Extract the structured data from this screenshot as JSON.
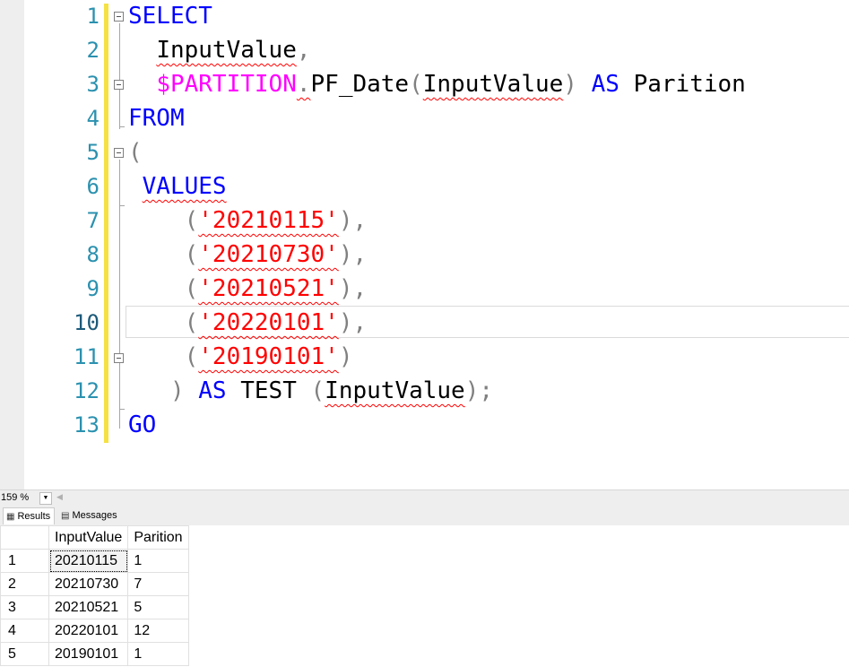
{
  "editor": {
    "line_numbers": [
      "1",
      "2",
      "3",
      "4",
      "5",
      "6",
      "7",
      "8",
      "9",
      "10",
      "11",
      "12",
      "13"
    ],
    "lines": [
      [
        {
          "t": "SELECT",
          "c": "kw"
        }
      ],
      [
        {
          "t": "  "
        },
        {
          "t": "InputValue",
          "c": "sq"
        },
        {
          "t": ",",
          "c": "op"
        }
      ],
      [
        {
          "t": "  "
        },
        {
          "t": "$PARTITION",
          "c": "fn"
        },
        {
          "t": ".",
          "c": "op sq"
        },
        {
          "t": "PF_Date"
        },
        {
          "t": "(",
          "c": "op"
        },
        {
          "t": "InputValue",
          "c": "sq"
        },
        {
          "t": ")",
          "c": "op"
        },
        {
          "t": " "
        },
        {
          "t": "AS",
          "c": "kw"
        },
        {
          "t": " Parition"
        }
      ],
      [
        {
          "t": "FROM",
          "c": "kw"
        }
      ],
      [
        {
          "t": "(",
          "c": "op"
        }
      ],
      [
        {
          "t": " "
        },
        {
          "t": "VALUES",
          "c": "kw sq"
        }
      ],
      [
        {
          "t": "    "
        },
        {
          "t": "(",
          "c": "op"
        },
        {
          "t": "'20210115'",
          "c": "str sq"
        },
        {
          "t": "),",
          "c": "op"
        }
      ],
      [
        {
          "t": "    "
        },
        {
          "t": "(",
          "c": "op"
        },
        {
          "t": "'20210730'",
          "c": "str sq"
        },
        {
          "t": "),",
          "c": "op"
        }
      ],
      [
        {
          "t": "    "
        },
        {
          "t": "(",
          "c": "op"
        },
        {
          "t": "'20210521'",
          "c": "str sq"
        },
        {
          "t": "),",
          "c": "op"
        }
      ],
      [
        {
          "t": "    "
        },
        {
          "t": "(",
          "c": "op"
        },
        {
          "t": "'20220101'",
          "c": "str sq"
        },
        {
          "t": "),",
          "c": "op"
        }
      ],
      [
        {
          "t": "    "
        },
        {
          "t": "(",
          "c": "op"
        },
        {
          "t": "'20190101'",
          "c": "str sq"
        },
        {
          "t": ")",
          "c": "op"
        }
      ],
      [
        {
          "t": "   "
        },
        {
          "t": ")",
          "c": "op"
        },
        {
          "t": " "
        },
        {
          "t": "AS",
          "c": "kw"
        },
        {
          "t": " TEST "
        },
        {
          "t": "(",
          "c": "op"
        },
        {
          "t": "InputValue",
          "c": "sq"
        },
        {
          "t": ");",
          "c": "op"
        }
      ],
      [
        {
          "t": "GO",
          "c": "kw"
        }
      ]
    ]
  },
  "statusbar": {
    "zoom": "159 %"
  },
  "tabs": {
    "results": "Results",
    "messages": "Messages"
  },
  "grid": {
    "columns": [
      "InputValue",
      "Parition"
    ],
    "rows": [
      {
        "n": "1",
        "input": "20210115",
        "part": "1"
      },
      {
        "n": "2",
        "input": "20210730",
        "part": "7"
      },
      {
        "n": "3",
        "input": "20210521",
        "part": "5"
      },
      {
        "n": "4",
        "input": "20220101",
        "part": "12"
      },
      {
        "n": "5",
        "input": "20190101",
        "part": "1"
      }
    ]
  }
}
